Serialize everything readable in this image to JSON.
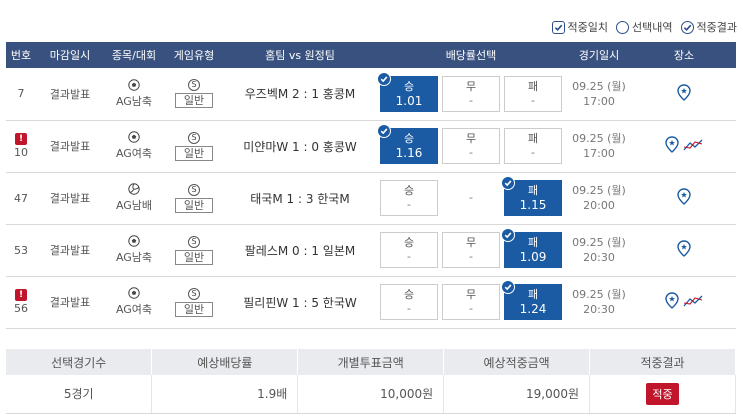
{
  "legend": {
    "items": [
      {
        "label": "적중일치",
        "checked": true,
        "shape": "square"
      },
      {
        "label": "선택내역",
        "checked": false,
        "shape": "round"
      },
      {
        "label": "적중결과",
        "checked": true,
        "shape": "round"
      }
    ]
  },
  "table": {
    "headers": [
      "번호",
      "마감일시",
      "종목/대회",
      "게임유형",
      "홈팀 vs 원정팀",
      "배당률선택",
      "경기일시",
      "장소"
    ],
    "rows": [
      {
        "no": "7",
        "alert": false,
        "deadline": "결과발표",
        "sport_icon": "soccer-ball-icon",
        "sport": "AG남축",
        "type_icon": "S",
        "type": "일반",
        "match": "우즈벡M 2 : 1 홍콩M",
        "odds": [
          {
            "label": "승",
            "value": "1.01",
            "selected": true,
            "plain": false
          },
          {
            "label": "무",
            "value": "-",
            "selected": false,
            "plain": false
          },
          {
            "label": "패",
            "value": "-",
            "selected": false,
            "plain": false
          }
        ],
        "date": "09.25 (월)",
        "time": "17:00",
        "chart": false
      },
      {
        "no": "10",
        "alert": true,
        "deadline": "결과발표",
        "sport_icon": "soccer-ball-icon",
        "sport": "AG여축",
        "type_icon": "S",
        "type": "일반",
        "match": "미얀마W 1 : 0 홍콩W",
        "odds": [
          {
            "label": "승",
            "value": "1.16",
            "selected": true,
            "plain": false
          },
          {
            "label": "무",
            "value": "-",
            "selected": false,
            "plain": false
          },
          {
            "label": "패",
            "value": "-",
            "selected": false,
            "plain": false
          }
        ],
        "date": "09.25 (월)",
        "time": "17:00",
        "chart": true
      },
      {
        "no": "47",
        "alert": false,
        "deadline": "결과발표",
        "sport_icon": "volleyball-icon",
        "sport": "AG남배",
        "type_icon": "S",
        "type": "일반",
        "match": "태국M 1 : 3 한국M",
        "odds": [
          {
            "label": "승",
            "value": "-",
            "selected": false,
            "plain": false
          },
          {
            "label": "",
            "value": "-",
            "selected": false,
            "plain": true
          },
          {
            "label": "패",
            "value": "1.15",
            "selected": true,
            "plain": false
          }
        ],
        "date": "09.25 (월)",
        "time": "20:00",
        "chart": false
      },
      {
        "no": "53",
        "alert": false,
        "deadline": "결과발표",
        "sport_icon": "soccer-ball-icon",
        "sport": "AG남축",
        "type_icon": "S",
        "type": "일반",
        "match": "팔레스M 0 : 1 일본M",
        "odds": [
          {
            "label": "승",
            "value": "-",
            "selected": false,
            "plain": false
          },
          {
            "label": "무",
            "value": "-",
            "selected": false,
            "plain": false
          },
          {
            "label": "패",
            "value": "1.09",
            "selected": true,
            "plain": false
          }
        ],
        "date": "09.25 (월)",
        "time": "20:30",
        "chart": false
      },
      {
        "no": "56",
        "alert": true,
        "deadline": "결과발표",
        "sport_icon": "soccer-ball-icon",
        "sport": "AG여축",
        "type_icon": "S",
        "type": "일반",
        "match": "필리핀W 1 : 5 한국W",
        "odds": [
          {
            "label": "승",
            "value": "-",
            "selected": false,
            "plain": false
          },
          {
            "label": "무",
            "value": "-",
            "selected": false,
            "plain": false
          },
          {
            "label": "패",
            "value": "1.24",
            "selected": true,
            "plain": false
          }
        ],
        "date": "09.25 (월)",
        "time": "20:30",
        "chart": true
      }
    ],
    "alert_mark": "!"
  },
  "summary": {
    "headers": [
      "선택경기수",
      "예상배당률",
      "개별투표금액",
      "예상적중금액",
      "적중결과"
    ],
    "values": [
      "5경기",
      "1.9배",
      "10,000원",
      "19,000원"
    ],
    "result": "적중"
  },
  "colors": {
    "header_bg": "#39517e",
    "selected_bg": "#1a5ba3",
    "alert": "#c0152b"
  }
}
